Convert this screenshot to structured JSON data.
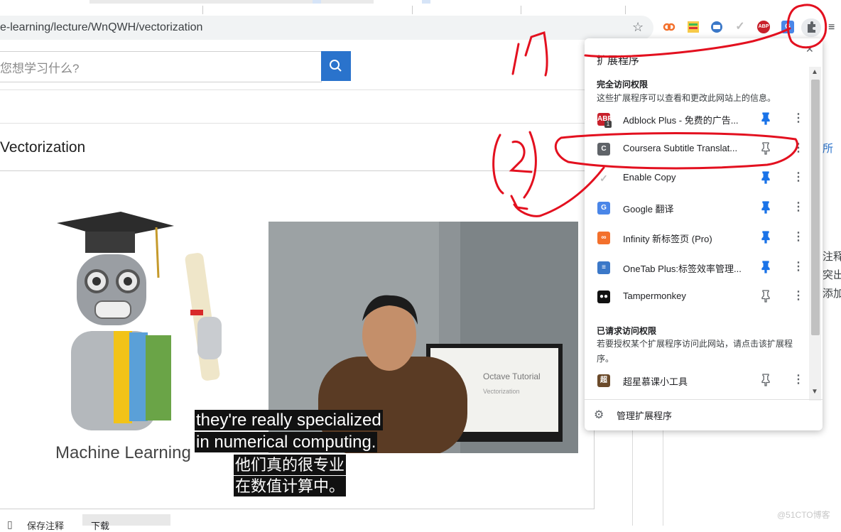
{
  "browser": {
    "url": "e-learning/lecture/WnQWH/vectorization",
    "toolbar_icons": [
      "bookmark-star-icon",
      "infinity-ext-icon",
      "onetab-ext-icon",
      "notes-ext-icon",
      "check-ext-icon",
      "adblock-ext-icon",
      "translate-ext-icon",
      "extensions-puzzle-icon",
      "reading-list-icon"
    ],
    "adblock_badge": "ABP"
  },
  "page": {
    "search_placeholder": "您想学习什么?",
    "lecture_title": "Vectorization",
    "bottom_fragments": [
      "保存注释",
      "下载"
    ],
    "side_fragments": [
      "所",
      "注释",
      "突出",
      "添加"
    ]
  },
  "video": {
    "slide_logo_text": "Machine Learning",
    "monitor_title": "Octave Tutorial",
    "monitor_sub": "Vectorization",
    "subtitles_en": [
      "they're really specialized",
      "in numerical computing."
    ],
    "subtitles_zh": [
      "他们真的很专业",
      "在数值计算中。"
    ]
  },
  "popup": {
    "title": "扩展程序",
    "full_access": {
      "heading": "完全访问权限",
      "description": "这些扩展程序可以查看和更改此网站上的信息。",
      "items": [
        {
          "name": "Adblock Plus - 免费的广告...",
          "icon_text": "ABP",
          "icon_color": "#c8202b",
          "badge": "1",
          "pinned": true
        },
        {
          "name": "Coursera Subtitle Translat...",
          "icon_text": "C",
          "icon_color": "#5f6368",
          "pinned": false
        },
        {
          "name": "Enable Copy",
          "icon_text": "✓",
          "icon_color": "#ffffff",
          "pinned": true
        },
        {
          "name": "Google 翻译",
          "icon_text": "G",
          "icon_color": "#4a86e8",
          "pinned": true
        },
        {
          "name": "Infinity 新标签页 (Pro)",
          "icon_text": "∞",
          "icon_color": "#f3702c",
          "pinned": true
        },
        {
          "name": "OneTab Plus:标签效率管理...",
          "icon_text": "≡",
          "icon_color": "#3b78c8",
          "pinned": true
        },
        {
          "name": "Tampermonkey",
          "icon_text": "●●",
          "icon_color": "#111111",
          "pinned": false
        }
      ]
    },
    "requested_access": {
      "heading": "已请求访问权限",
      "description": "若要授权某个扩展程序访问此网站，请点击该扩展程序。",
      "items": [
        {
          "name": "超星慕课小工具",
          "icon_text": "超",
          "icon_color": "#6b4a2a",
          "pinned": false
        }
      ]
    },
    "manage_label": "管理扩展程序"
  },
  "annotations": {
    "mark_1": "1",
    "mark_2": "2",
    "color": "#e3101f"
  },
  "watermark": "@51CTO博客",
  "colors": {
    "accent": "#2a73cc",
    "pin_blue": "#1a73e8",
    "annotation_red": "#e3101f"
  }
}
